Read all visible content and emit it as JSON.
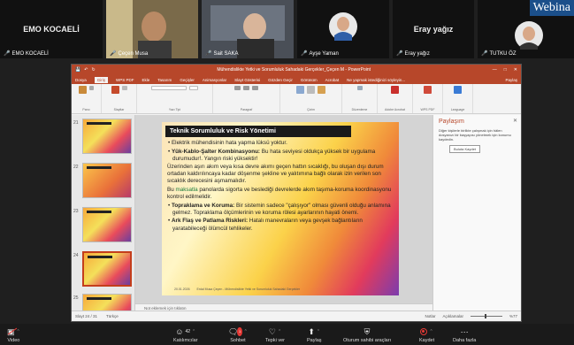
{
  "participants": {
    "tiles": [
      {
        "display": "EMO KOCAELİ",
        "label": "EMO KOCAELİ"
      },
      {
        "display": "",
        "label": "Çeçen Musa"
      },
      {
        "display": "",
        "label": "Sait SAKA"
      },
      {
        "display": "",
        "label": "Ayşe Yaman"
      },
      {
        "display": "Eray yağız",
        "label": "Eray yağız"
      },
      {
        "display": "",
        "label": "TUTKU ÖZ"
      }
    ],
    "webinar_tag": "Webina"
  },
  "ppt": {
    "window_title": "Mühendislikte Yetki ve Sorumluluk Sahadaki Gerçekler_Çeçen M - PowerPoint",
    "menu": [
      "Dosya",
      "Giriş",
      "WPS PDF",
      "Ekle",
      "Tasarım",
      "Geçişler",
      "Animasyonlar",
      "Slayt Gösterisi",
      "Gözden Geçir",
      "Görünüm",
      "Acrobat",
      "Ne yapmak istediğinizi söyleyin..."
    ],
    "share": "Paylaş",
    "ribbon_groups": [
      "Pano",
      "Slaytlar",
      "Yazı Tipi",
      "Paragraf",
      "Çizim",
      "Düzenleme",
      "Adobe Acrobat",
      "WPS PDF",
      "Language"
    ],
    "thumb_numbers": [
      "21",
      "22",
      "23",
      "24",
      "25"
    ],
    "slide": {
      "title": "Teknik Sorumluluk ve Risk Yönetimi",
      "bullet1": "Elektrik mühendisinin hata yapma lüksü yoktur.",
      "bullet2_bold": "Yük-Kablo-Şalter Kombinasyonu:",
      "bullet2_text": " Bu hata seviyesi oldukça yüksek bir uygulama durumudur!. Yangın riski yüksektir!",
      "para1": "Üzerinden aşırı akım veya kısa devre akımı geçen hattın sıcaklığı, bu oluşan dışı durum ortadan kaldırılıncaya kadar döşenme şekline ve yalıtımına bağlı olarak izin verilen son sıcaklık derecesini aşmamalıdır.",
      "para2_pre": "Bu ",
      "para2_hl": "maksatla",
      "para2_text": " panolarda sigorta ve beslediği devrelerde akım taşıma-koruma koordinasyonu kontrol edilmelidir.",
      "bullet3_bold": "Topraklama ve Koruma:",
      "bullet3_text": " Bir sistemin sadece \"çalışıyor\" olması güvenli olduğu anlamına gelmez. Topraklama ölçümlerinin ve koruma rölesi ayarlarının hayati önemi.",
      "bullet4_bold": "Ark Flaş ve Patlama Riskleri:",
      "bullet4_text": " Hatalı manevraların veya gevşek bağlantıların yaratabileceği ölümcül tehlikeler.",
      "footer_date": "20.01.2026",
      "footer_text": "Erdal Musa Çeçen - Mühendislikte Yetki ve Sorumluluk Sahadaki Gerçekler"
    },
    "notes_placeholder": "Not eklemek için tıklatın",
    "side_panel": {
      "title": "Paylaşım",
      "text": "Diğer kişilerle birlikte çalışmak için hâlen dosyanızı bir başyapısı yönetmek için konumu kaydedin.",
      "button": "Buluta Kaydet"
    },
    "status": {
      "slide_count": "Slayt 24 / 31",
      "language": "Türkçe",
      "notes": "Notlar",
      "comments": "Açıklamalar",
      "zoom": "%77"
    }
  },
  "toolbar": {
    "video": "Video",
    "participants": "Katılımcılar",
    "participants_count": "42",
    "chat": "Sohbet",
    "chat_badge": "1",
    "reactions": "Tepki ver",
    "share": "Paylaş",
    "host_tools": "Oturum sahibi araçları",
    "record": "Kaydet",
    "more": "Daha fazla"
  }
}
